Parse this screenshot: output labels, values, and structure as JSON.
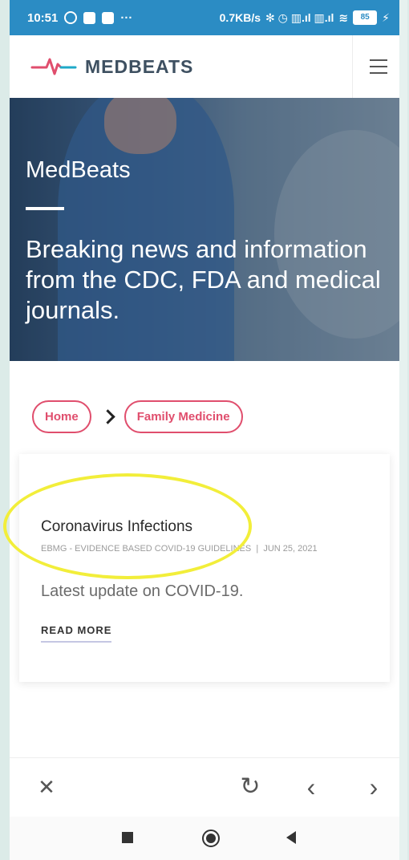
{
  "status_bar": {
    "time": "10:51",
    "ellipsis": "···",
    "network_speed": "0.7KB/s",
    "signal_text": "✻ ◷ ▥.ıl ▥.ıl",
    "wifi": "≋",
    "battery": "85",
    "bolt": "⚡"
  },
  "header": {
    "brand": "MEDBEATS"
  },
  "hero": {
    "title": "MedBeats",
    "subtitle": "Breaking news and information from the CDC, FDA and medical journals."
  },
  "breadcrumb": {
    "home": "Home",
    "category": "Family Medicine"
  },
  "article": {
    "title": "Coronavirus Infections",
    "source": "EBMG - EVIDENCE BASED COVID-19 GUIDELINES",
    "separator": "|",
    "date": "JUN 25, 2021",
    "excerpt": "Latest update on COVID-19.",
    "read_more": "READ MORE"
  },
  "browser_bar": {
    "close": "✕",
    "reload": "↻",
    "back": "‹",
    "forward": "›"
  },
  "colors": {
    "accent": "#e04e6d",
    "status_bar": "#2b8cc4",
    "highlight": "#f2ee3a"
  },
  "icons": [
    "whatsapp-icon",
    "notification-icon",
    "app-c-icon",
    "bluetooth-icon",
    "alarm-icon",
    "signal-icon",
    "wifi-icon",
    "battery-icon",
    "logo-heartbeat-icon",
    "hamburger-menu-icon",
    "chevron-right-icon",
    "close-icon",
    "reload-icon",
    "back-icon",
    "forward-icon"
  ]
}
